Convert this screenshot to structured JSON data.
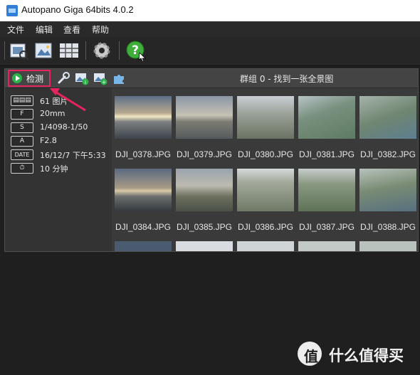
{
  "window": {
    "title": "Autopano Giga 64bits 4.0.2"
  },
  "menu": {
    "items": [
      "文件",
      "编辑",
      "查看",
      "帮助"
    ]
  },
  "toolbar": {
    "buttons": [
      "open-folder-icon",
      "import-images-icon",
      "batch-grid-icon",
      "settings-gear-icon",
      "help-icon"
    ]
  },
  "group": {
    "detect_label": "检测",
    "status": "群组 0 - 找到一张全景图",
    "info": [
      {
        "key": "▤▤▤",
        "value": "61 图片"
      },
      {
        "key": "F",
        "value": "20mm"
      },
      {
        "key": "S",
        "value": "1/4098-1/50"
      },
      {
        "key": "A",
        "value": "F2.8"
      },
      {
        "key": "DATE",
        "value": "16/12/7 下午5:33"
      },
      {
        "key": "⏱",
        "value": "10 分钟"
      }
    ]
  },
  "thumbnails": [
    "DJI_0378.JPG",
    "DJI_0379.JPG",
    "DJI_0380.JPG",
    "DJI_0381.JPG",
    "DJI_0382.JPG",
    "DJI_0384.JPG",
    "DJI_0385.JPG",
    "DJI_0386.JPG",
    "DJI_0387.JPG",
    "DJI_0388.JPG"
  ],
  "watermark": {
    "text": "什么值得买",
    "logo": "值"
  }
}
